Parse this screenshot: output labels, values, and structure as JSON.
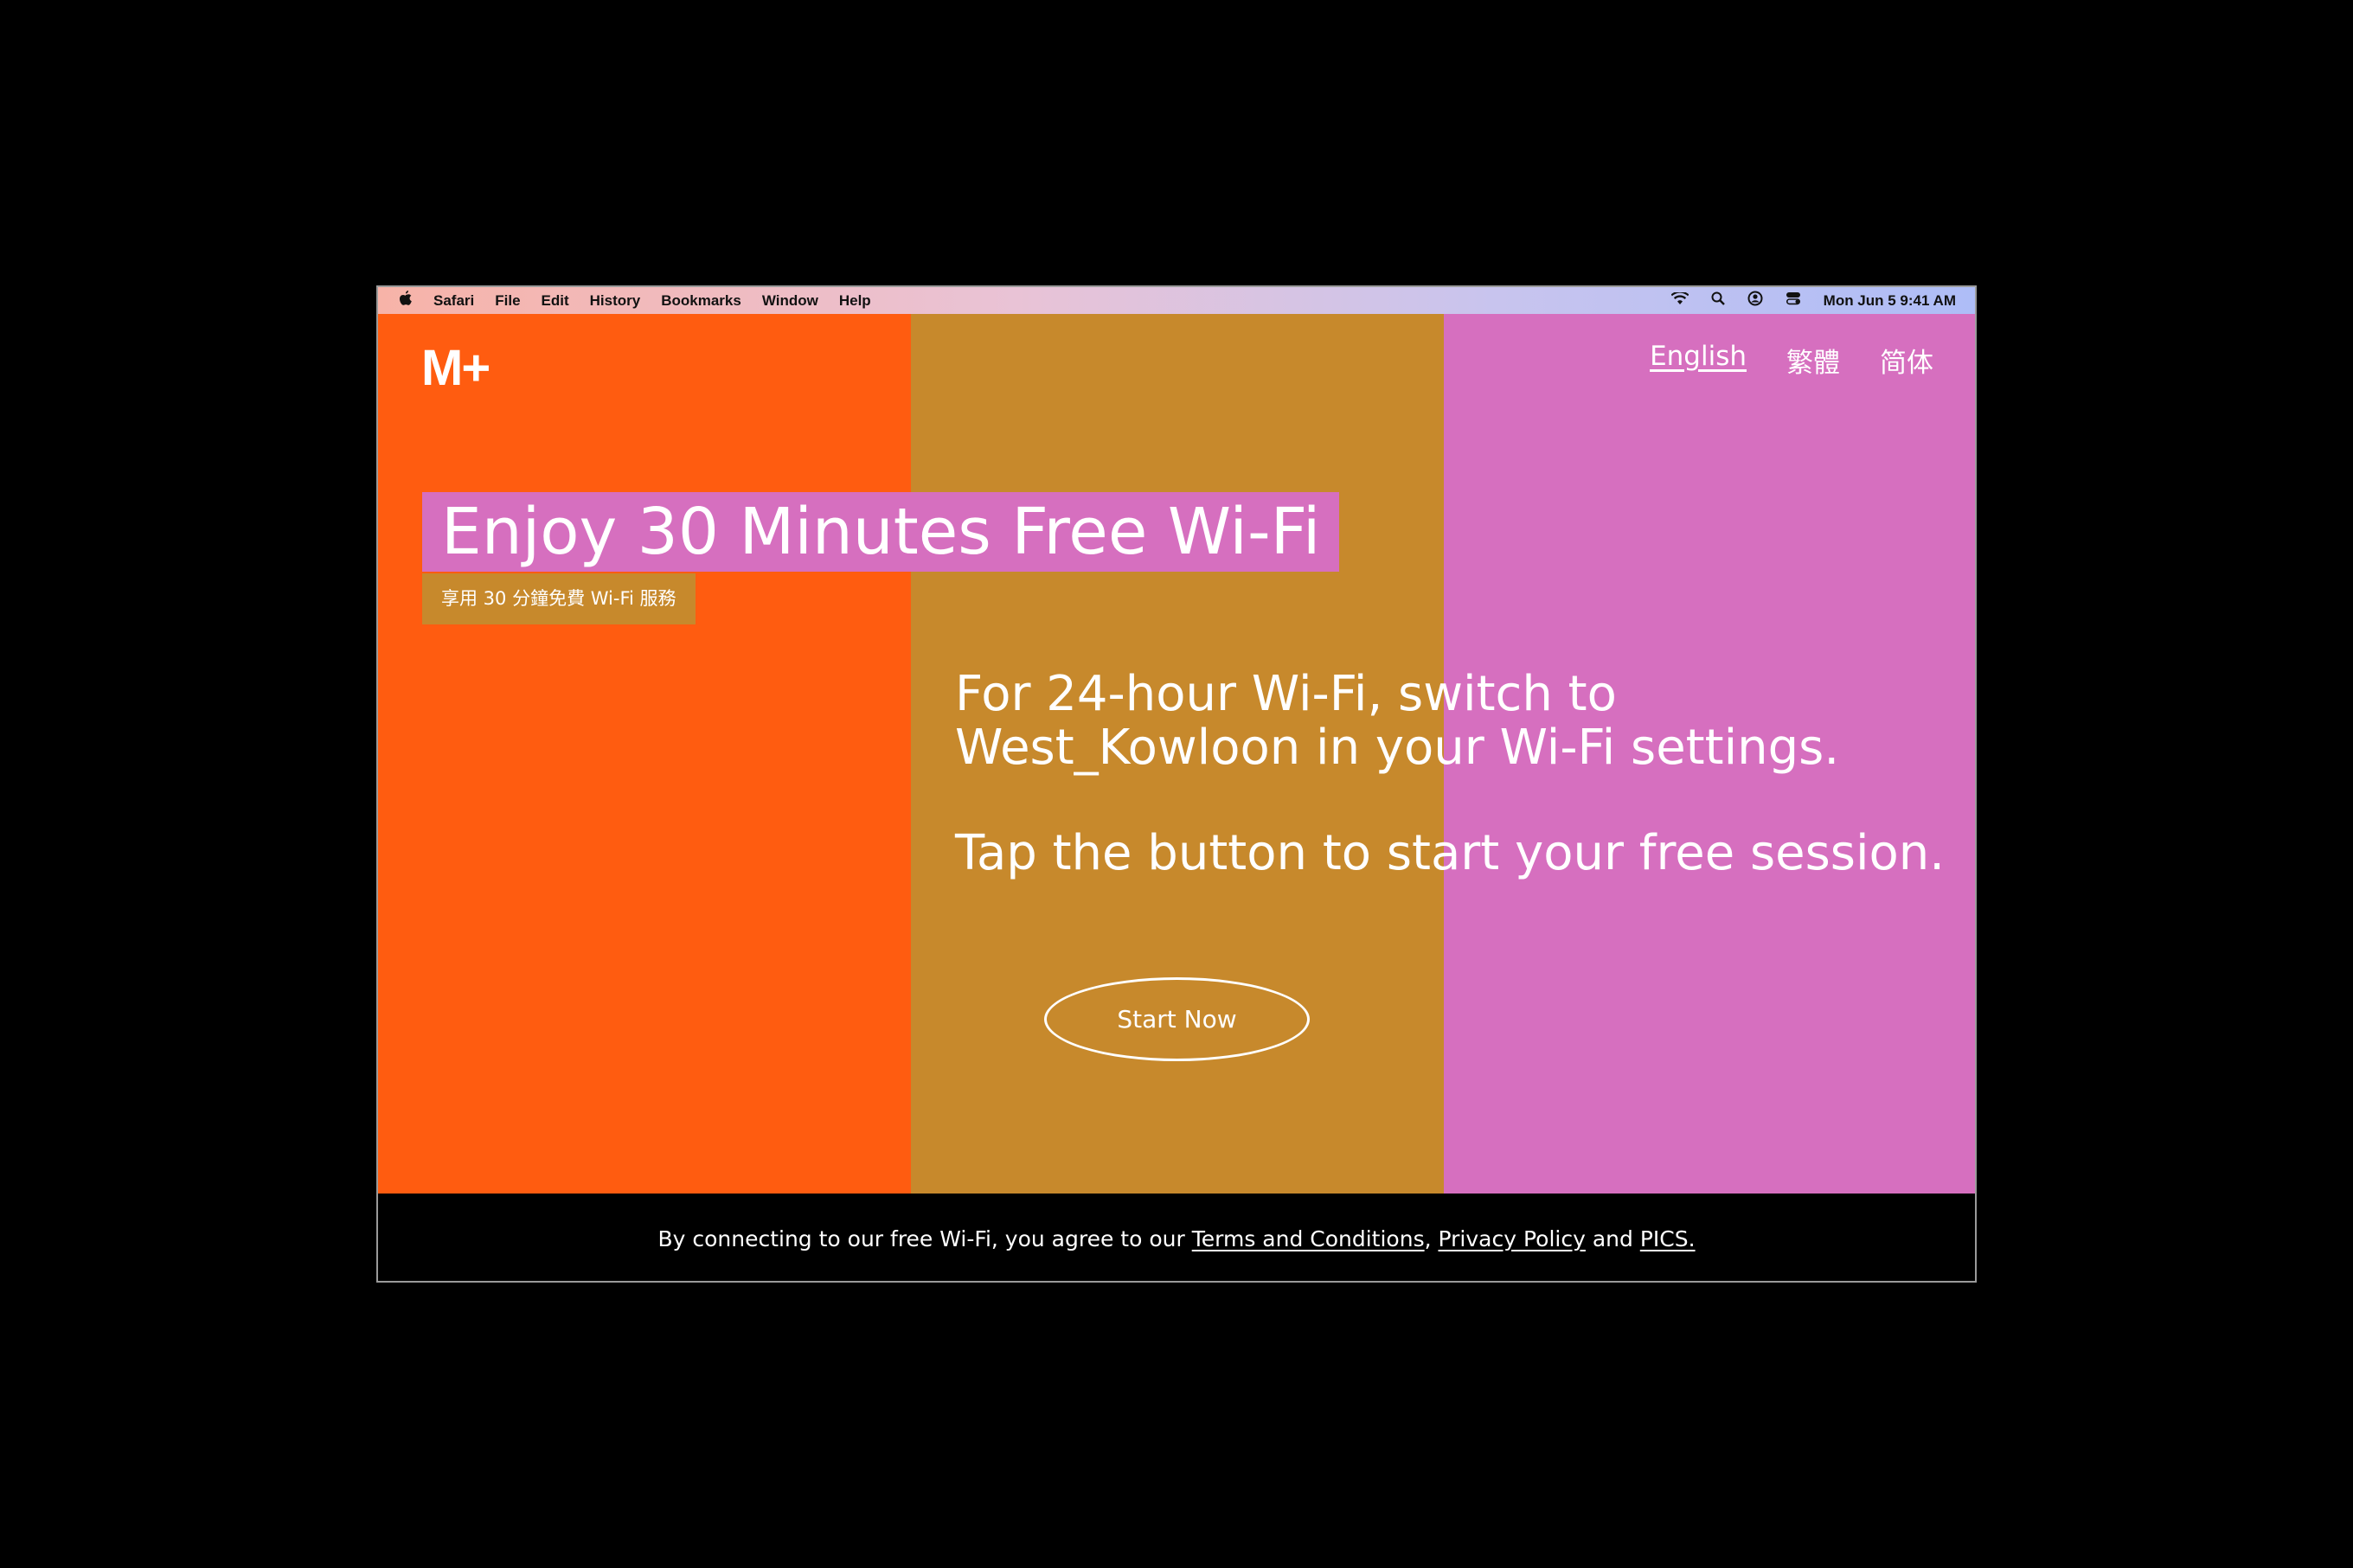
{
  "menubar": {
    "app": "Safari",
    "items": [
      "File",
      "Edit",
      "History",
      "Bookmarks",
      "Window",
      "Help"
    ],
    "status_icons": [
      "wifi-icon",
      "search-icon",
      "user-icon",
      "control-center-icon"
    ],
    "datetime": "Mon Jun 5  9:41 AM"
  },
  "logo": "M+",
  "languages": [
    "English",
    "繁體",
    "简体"
  ],
  "colors": {
    "orange": "#ff5c10",
    "ochre": "#c7892c",
    "pink": "#d66fbf"
  },
  "heading": "Enjoy 30 Minutes Free Wi-Fi",
  "subheading": "享用 30 分鐘免費 Wi-Fi 服務",
  "body": {
    "line1": "For 24-hour Wi-Fi, switch to",
    "line2": "West_Kowloon in your Wi-Fi settings.",
    "line3": "Tap the button to start your free session."
  },
  "button": "Start Now",
  "footer": {
    "prefix": "By connecting to our free Wi-Fi, you agree to our ",
    "terms": "Terms and Conditions",
    "sep": ", ",
    "privacy": "Privacy Policy",
    "and": " and ",
    "pics": "PICS."
  }
}
